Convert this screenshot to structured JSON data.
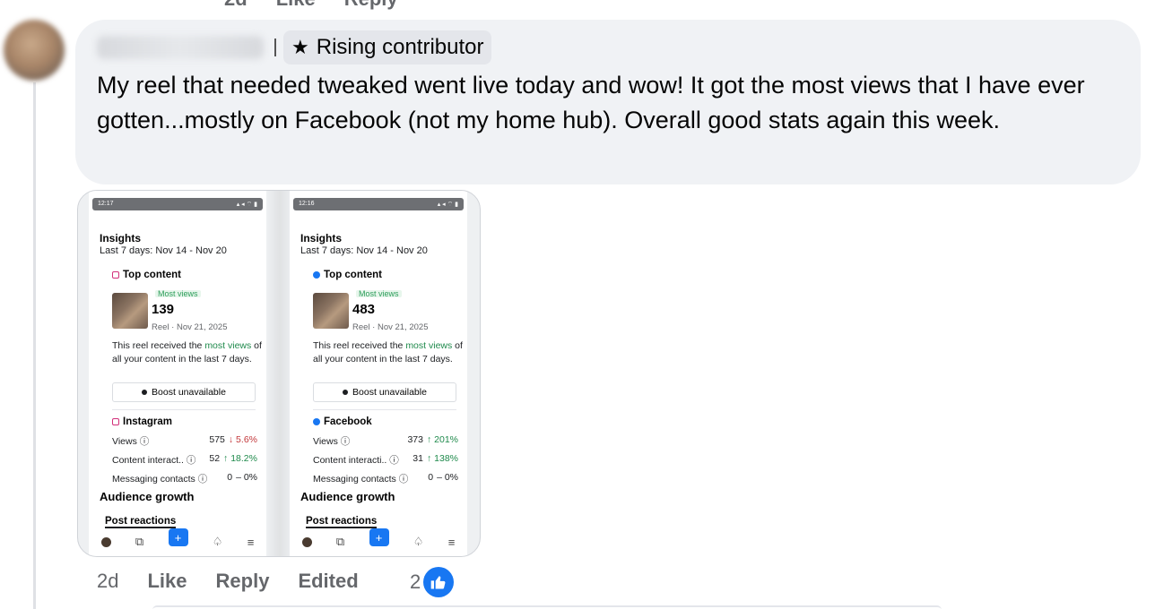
{
  "prev_actions": {
    "age": "2d",
    "like": "Like",
    "reply": "Reply"
  },
  "comment": {
    "badge": {
      "icon": "star-icon",
      "label": "Rising contributor"
    },
    "text": "My reel that needed tweaked went live today and wow! It got the most views that I have ever gotten...mostly on Facebook (not my home hub). Overall good stats again this week."
  },
  "attachment": {
    "phones": [
      {
        "time": "12:17",
        "title": "Insights",
        "range": "Last 7 days: Nov 14 - Nov 20",
        "top_content": "Top content",
        "most_views": "Most views",
        "views_count": "139",
        "reel_date": "Reel · Nov 21, 2025",
        "desc_pre": "This reel received the ",
        "desc_hl": "most views",
        "desc_post": " of all your content in the last 7 days.",
        "boost": "Boost unavailable",
        "platform": "Instagram",
        "metrics": [
          {
            "label": "Views ⓘ",
            "value": "575",
            "change": "↓ 5.6%",
            "dir": "down"
          },
          {
            "label": "Content interact.. ⓘ",
            "value": "52",
            "change": "↑ 18.2%",
            "dir": "up"
          },
          {
            "label": "Messaging contacts ⓘ",
            "value": "0",
            "change": "– 0%",
            "dir": "flat"
          }
        ],
        "audience": "Audience growth",
        "post_reactions": "Post reactions"
      },
      {
        "time": "12:16",
        "title": "Insights",
        "range": "Last 7 days: Nov 14 - Nov 20",
        "top_content": "Top content",
        "most_views": "Most views",
        "views_count": "483",
        "reel_date": "Reel · Nov 21, 2025",
        "desc_pre": "This reel received the ",
        "desc_hl": "most views",
        "desc_post": " of all your content in the last 7 days.",
        "boost": "Boost unavailable",
        "platform": "Facebook",
        "metrics": [
          {
            "label": "Views ⓘ",
            "value": "373",
            "change": "↑ 201%",
            "dir": "up"
          },
          {
            "label": "Content interacti.. ⓘ",
            "value": "31",
            "change": "↑ 138%",
            "dir": "up"
          },
          {
            "label": "Messaging contacts ⓘ",
            "value": "0",
            "change": "– 0%",
            "dir": "flat"
          }
        ],
        "audience": "Audience growth",
        "post_reactions": "Post reactions"
      }
    ]
  },
  "actions": {
    "age": "2d",
    "like": "Like",
    "reply": "Reply",
    "edited": "Edited"
  },
  "reactions": {
    "count": "2",
    "icon": "thumbs-up-icon",
    "color": "#1877f2"
  }
}
